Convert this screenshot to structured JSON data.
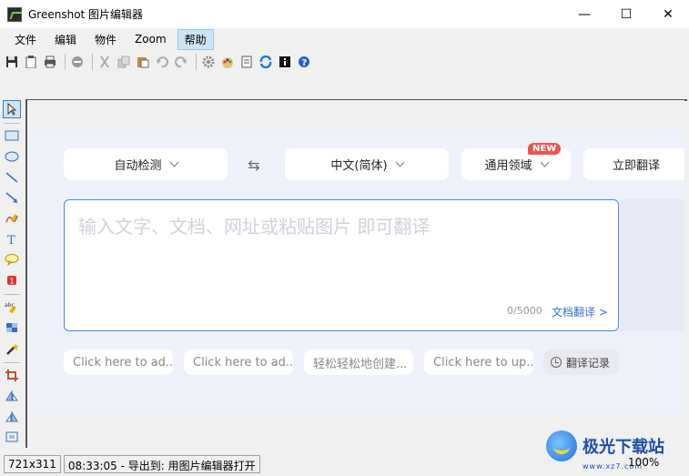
{
  "window": {
    "title": "Greenshot 图片编辑器",
    "minimize": "—",
    "maximize": "☐",
    "close": "✕"
  },
  "menu": {
    "items": [
      "文件",
      "编辑",
      "物件",
      "Zoom",
      "帮助"
    ],
    "active_index": 4
  },
  "toolbar_icons": [
    "save-icon",
    "clipboard-icon",
    "print-icon",
    "delete-icon",
    "cut-icon",
    "copy-icon",
    "paste-icon",
    "undo-icon",
    "redo-icon",
    "settings-icon",
    "paint-icon",
    "file-icon",
    "refresh-icon",
    "info-icon",
    "help-icon"
  ],
  "tools": [
    "select-tool-icon",
    "rectangle-tool-icon",
    "ellipse-tool-icon",
    "line-tool-icon",
    "arrow-tool-icon",
    "freehand-tool-icon",
    "text-tool-icon",
    "speechbubble-tool-icon",
    "counter-tool-icon",
    "highlight-tool-icon",
    "obfuscate-tool-icon",
    "magic-tool-icon",
    "crop-tool-icon",
    "rotate-left-icon",
    "rotate-right-icon",
    "resize-icon"
  ],
  "translator": {
    "source_lang": "自动检测",
    "target_lang": "中文(简体)",
    "domain": "通用领域",
    "new_badge": "NEW",
    "translate_button": "立即翻译",
    "placeholder": "输入文字、文档、网址或粘贴图片 即可翻译",
    "char_count": "0/5000",
    "doc_translate": "文档翻译 >",
    "chips": [
      "Click here to ad...",
      "Click here to ad...",
      "轻松轻松地创建...",
      "Click here to up..."
    ],
    "history": "翻译记录"
  },
  "status": {
    "size": "721x311",
    "message": "08:33:05 - 导出到: 用图片编辑器打开",
    "zoom": "100%"
  },
  "watermark": {
    "text": "极光下载站",
    "url": "www.xz7.com"
  }
}
